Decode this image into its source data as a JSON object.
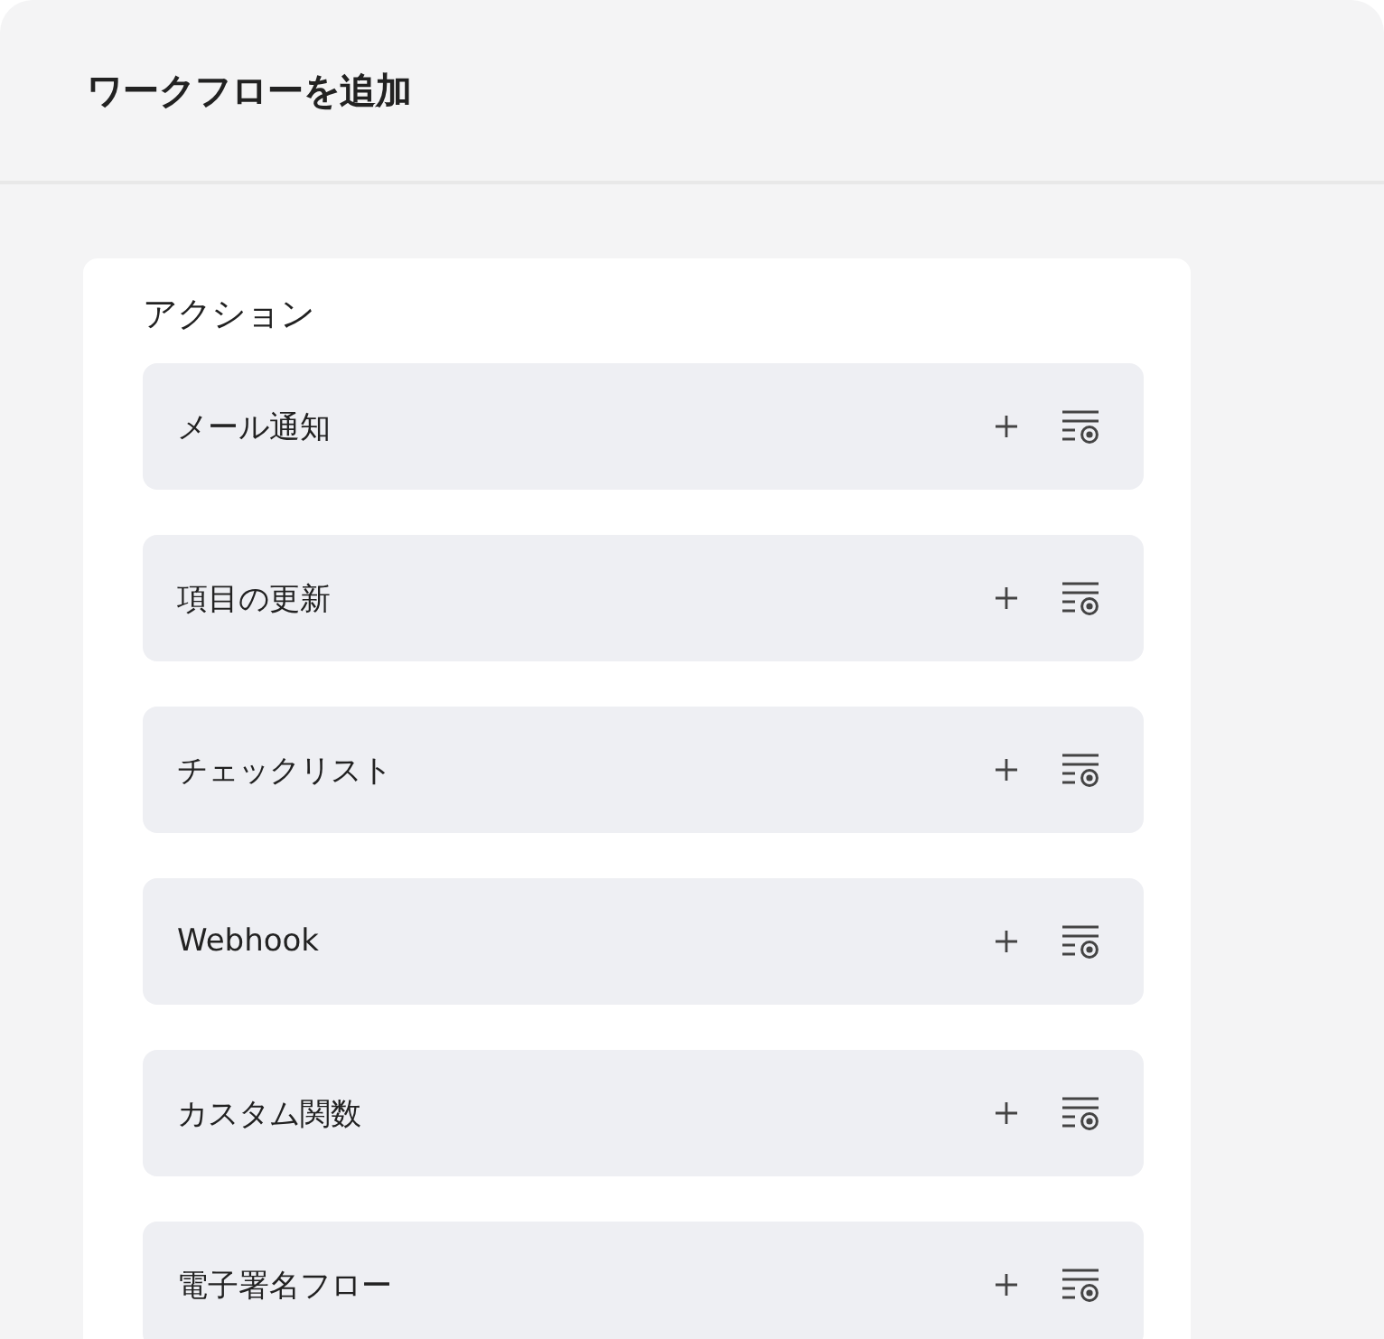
{
  "header": {
    "title": "ワークフローを追加"
  },
  "section": {
    "title": "アクション",
    "items": [
      {
        "label": "メール通知"
      },
      {
        "label": "項目の更新"
      },
      {
        "label": "チェックリスト"
      },
      {
        "label": "Webhook"
      },
      {
        "label": "カスタム関数"
      },
      {
        "label": "電子署名フロー"
      }
    ]
  }
}
